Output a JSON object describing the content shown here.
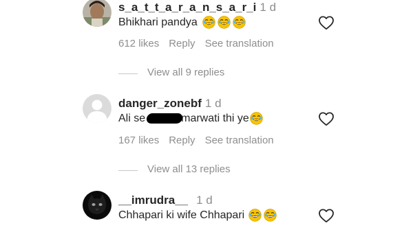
{
  "comments": [
    {
      "username": "s_a_t_t_a_r_a_n_s_a_r_i",
      "time": "1 d",
      "text": "Bhikhari pandya",
      "emoji_count": 3,
      "likes": "612 likes",
      "reply": "Reply",
      "translate": "See translation",
      "view_replies": "View all 9 replies",
      "avatar": "photo-avatar"
    },
    {
      "username": "danger_zonebf",
      "time": "1 d",
      "text_before": "Ali se",
      "text_after": "marwati thi ye",
      "emoji_count": 1,
      "likes": "167 likes",
      "reply": "Reply",
      "translate": "See translation",
      "view_replies": "View all 13 replies",
      "avatar": "default-avatar"
    },
    {
      "username": "__imrudra__",
      "time": "1 d",
      "text": "Chhapari ki wife Chhapari",
      "emoji_count": 2,
      "avatar": "black-cat-avatar"
    }
  ],
  "icons": {
    "like": "heart-outline-icon",
    "emoji": "laughing-tears-emoji"
  },
  "colors": {
    "text": "#262626",
    "secondary": "#8e8e8e",
    "emoji": "#f7c400"
  }
}
